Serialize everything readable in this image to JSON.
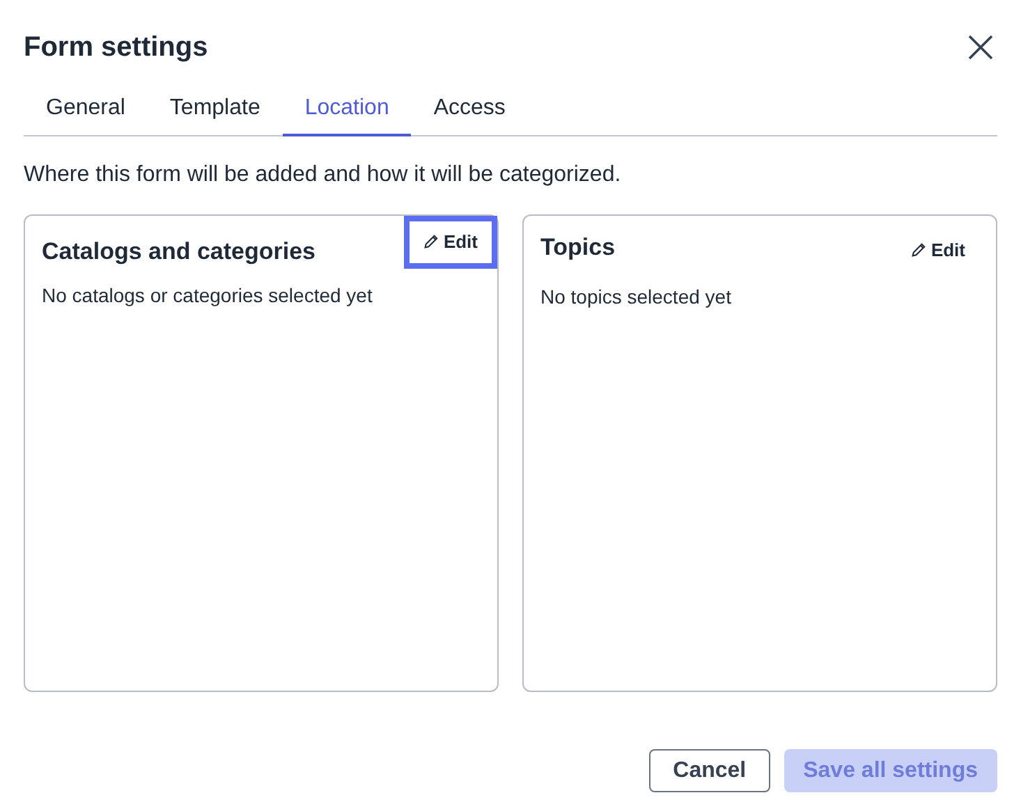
{
  "dialog": {
    "title": "Form settings"
  },
  "tabs": [
    {
      "label": "General",
      "selected": false
    },
    {
      "label": "Template",
      "selected": false
    },
    {
      "label": "Location",
      "selected": true
    },
    {
      "label": "Access",
      "selected": false
    }
  ],
  "description": "Where this form will be added and how it will be categorized.",
  "panels": [
    {
      "title": "Catalogs and categories",
      "edit": {
        "label": "Edit",
        "focused": true
      },
      "empty_text": "No catalogs or categories selected yet"
    },
    {
      "title": "Topics",
      "edit": {
        "label": "Edit",
        "focused": false
      },
      "empty_text": "No topics selected yet"
    }
  ],
  "buttons": [
    {
      "label": "Cancel",
      "kind": "secondary",
      "disabled": false
    },
    {
      "label": "Save all settings",
      "kind": "primary",
      "disabled": true
    }
  ]
}
